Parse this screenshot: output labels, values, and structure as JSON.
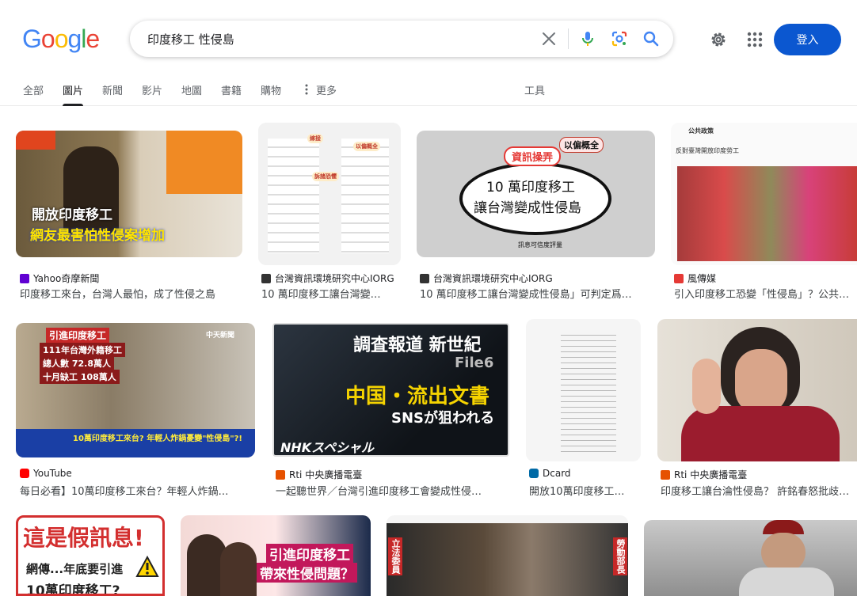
{
  "header": {
    "logo_letters": [
      "G",
      "o",
      "o",
      "g",
      "l",
      "e"
    ],
    "logo_colors": [
      "#4285f4",
      "#ea4335",
      "#fbbc05",
      "#4285f4",
      "#34a853",
      "#ea4335"
    ],
    "search_value": "印度移工 性侵島",
    "login_label": "登入"
  },
  "tabs": [
    "全部",
    "圖片",
    "新聞",
    "影片",
    "地圖",
    "書籍",
    "購物",
    "更多",
    "工具"
  ],
  "results": [
    {
      "source": "Yahoo奇摩新聞",
      "title": "印度移工來台，台灣人最怕，成了性侵之島",
      "overlay": [
        "開放印度移工",
        "網友最害怕性侵案增加"
      ]
    },
    {
      "source": "台灣資訊環境研究中心IORG",
      "title": "10 萬印度移工讓台灣變…",
      "overlay": [
        "嫁接",
        "以偏概全",
        "訴諸恐懼"
      ]
    },
    {
      "source": "台灣資訊環境研究中心IORG",
      "title": "10 萬印度移工讓台灣變成性侵島」可判定爲…",
      "overlay": [
        "以偏概全",
        "資訊操弄",
        "10 萬印度移工",
        "讓台灣變成性侵島",
        "訊息可信度評量"
      ]
    },
    {
      "source": "風傳媒",
      "title": "引入印度移工恐變「性侵島」？公共…",
      "overlay": [
        "公共政策",
        "反對臺灣開放印度勞工"
      ]
    },
    {
      "source": "YouTube",
      "title": "每日必看】10萬印度移工來台？年輕人炸鍋…",
      "overlay": [
        "引進印度移工",
        "111年台灣外籍移工",
        "總人數 72.8萬人",
        "十月缺工 108萬人",
        "中天新聞",
        "10萬印度移工來台? 年輕人炸鍋憂變\"性侵島\"?!"
      ]
    },
    {
      "source": "Rti 中央廣播電臺",
      "title": "一起聽世界／台灣引進印度移工會變成性侵…",
      "overlay": [
        "調査報道 新世紀",
        "File6",
        "中国・流出文書",
        "SNSが狙われる",
        "NHKスペシャル"
      ]
    },
    {
      "source": "Dcard",
      "title": "開放10萬印度移工…",
      "overlay": []
    },
    {
      "source": "Rti 中央廣播電臺",
      "title": "印度移工讓台淪性侵島？ 許銘春怒批歧…",
      "overlay": []
    },
    {
      "source": "",
      "title": "",
      "overlay": [
        "這是假訊息!",
        "網傳...年底要引進",
        "10萬印度移工?"
      ]
    },
    {
      "source": "",
      "title": "",
      "overlay": [
        "引進印度移工",
        "帶來性侵問題？"
      ]
    },
    {
      "source": "",
      "title": "",
      "overlay": [
        "立法委員",
        "勞動部長"
      ]
    },
    {
      "source": "",
      "title": "",
      "overlay": []
    }
  ],
  "colors": {
    "accent": "#0b57d0",
    "tab_text": "#5f6368",
    "divider": "#ebebeb"
  },
  "icons": [
    "clear-icon",
    "mic-icon",
    "lens-icon",
    "search-icon",
    "settings-icon",
    "apps-icon"
  ]
}
